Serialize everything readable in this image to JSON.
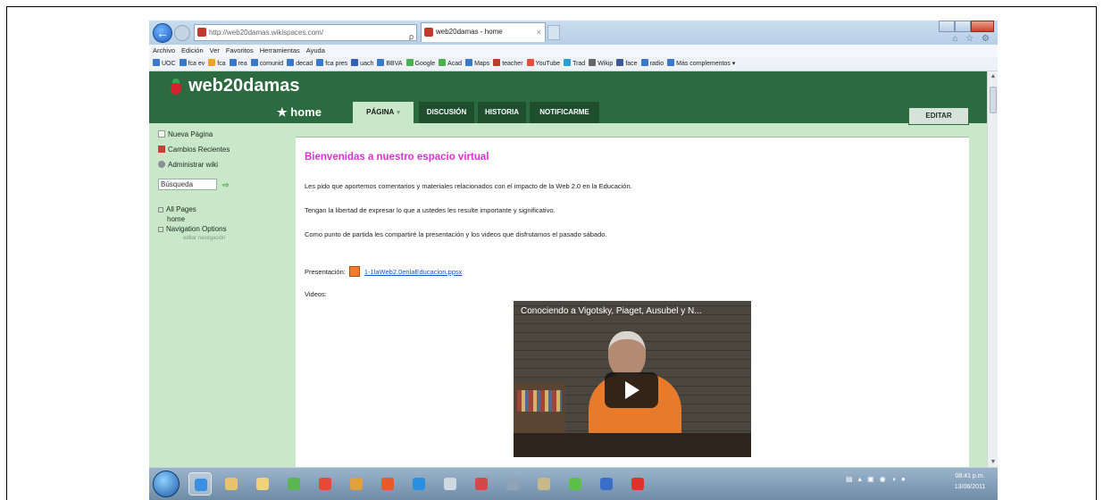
{
  "browser": {
    "address": "http://web20damas.wikispaces.com/",
    "address_tools": "ρ - ☰ C ✕",
    "tab_title": "web20damas - home",
    "tab_close": "×",
    "back_icon": "←",
    "tool_icons": "⌂ ☆ ⚙"
  },
  "menu": [
    "Archivo",
    "Edición",
    "Ver",
    "Favoritos",
    "Herramientas",
    "Ayuda"
  ],
  "favorites": [
    {
      "label": "UOC",
      "color": "#3a78c9"
    },
    {
      "label": "fca ev",
      "color": "#3a78c9"
    },
    {
      "label": "fca",
      "color": "#f0a21f"
    },
    {
      "label": "rea",
      "color": "#3a78c9"
    },
    {
      "label": "comunid",
      "color": "#3a78c9"
    },
    {
      "label": "decad",
      "color": "#3a78c9"
    },
    {
      "label": "fca pres",
      "color": "#3a78c9"
    },
    {
      "label": "uach",
      "color": "#2f63b5"
    },
    {
      "label": "BBVA",
      "color": "#3a78c9"
    },
    {
      "label": "Google",
      "color": "#4caf50"
    },
    {
      "label": "Acad",
      "color": "#4caf50"
    },
    {
      "label": "Maps",
      "color": "#3a78c9"
    },
    {
      "label": "teacher",
      "color": "#c0392b"
    },
    {
      "label": "YouTube",
      "color": "#e74c3c"
    },
    {
      "label": "Trad",
      "color": "#2a9fd6"
    },
    {
      "label": "Wikip",
      "color": "#666666"
    },
    {
      "label": "face",
      "color": "#3b5998"
    },
    {
      "label": "radio",
      "color": "#3a78c9"
    },
    {
      "label": "Más complementos ▾",
      "color": "#3a78c9"
    }
  ],
  "site": {
    "title": "web20damas",
    "home_link": "★ home",
    "tabs": {
      "pagina": "PÁGINA",
      "caret": "▾",
      "discusion": "DISCUSIÓN",
      "historia": "HISTORIA",
      "notificarme": "NOTIFICARME"
    },
    "edit": "EDITAR"
  },
  "sidebar": {
    "new_page": "Nueva Página",
    "recent_changes": "Cambios Recientes",
    "manage_wiki": "Administrar wiki",
    "search_value": "Búsqueda",
    "search_go": "⇨",
    "all_pages": "All Pages",
    "home": "home",
    "nav_options": "Navigation Options",
    "edit_nav": "editar navegación"
  },
  "content": {
    "welcome": "Bienvenidas a nuestro espacio virtual",
    "p1": "Les pido que aportemos comentarios y materiales relacionados con el impacto de la Web 2.0 en la Educación.",
    "p2": "Tengan la libertad de expresar lo que a ustedes les resulte importante y significativo.",
    "p3": "Como punto de partida les compartiré la presentación y los videos que disfrutamos el pasado sábado.",
    "presentation_label": "Presentación:",
    "presentation_file": "1-1laWeb2.0enlaEducacion.ppsx",
    "videos_label": "Videos:",
    "video_title": "Conociendo a Vigotsky, Piaget, Ausubel y N..."
  },
  "taskbar": {
    "apps": [
      {
        "name": "internet-explorer",
        "color": "#3a8fe0",
        "active": true
      },
      {
        "name": "file-explorer",
        "color": "#e7c36a",
        "active": false
      },
      {
        "name": "folder",
        "color": "#f0d27a",
        "active": false
      },
      {
        "name": "messenger",
        "color": "#5ab552",
        "active": false
      },
      {
        "name": "chrome",
        "color": "#e84a3a",
        "active": false
      },
      {
        "name": "paint",
        "color": "#e0a040",
        "active": false
      },
      {
        "name": "office",
        "color": "#e85a2a",
        "active": false
      },
      {
        "name": "skype",
        "color": "#2a8fe0",
        "active": false
      },
      {
        "name": "media-player",
        "color": "#d0d8e2",
        "active": false
      },
      {
        "name": "puzzle",
        "color": "#d04a4a",
        "active": false
      },
      {
        "name": "calculator",
        "color": "#8fa3b8",
        "active": false
      },
      {
        "name": "library",
        "color": "#c9b98a",
        "active": false
      },
      {
        "name": "evernote",
        "color": "#5cbf4a",
        "active": false
      },
      {
        "name": "word",
        "color": "#3a6fc9",
        "active": false
      },
      {
        "name": "acrobat",
        "color": "#e0322a",
        "active": false
      }
    ],
    "tray": "▤ ▴ ▣ ◉ ◑ ●",
    "time": "08:41 p.m.",
    "date": "13/06/2011"
  }
}
